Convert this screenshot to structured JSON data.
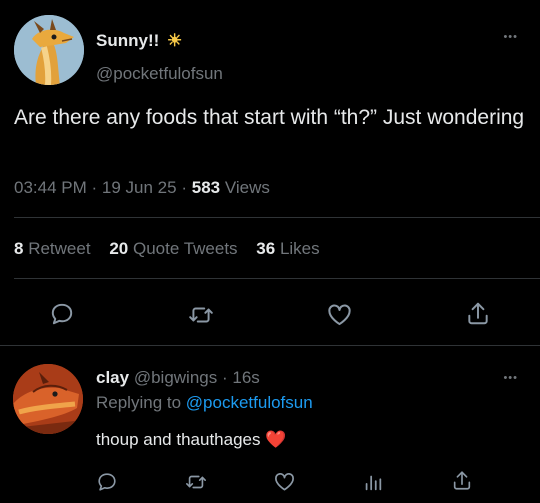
{
  "main_tweet": {
    "display_name": "Sunny!!",
    "name_emoji": "☀",
    "handle": "@pocketfulofsun",
    "text": "Are there any foods that start with “th?” Just wondering",
    "time": "03:44 PM",
    "date": "19 Jun 25",
    "views_count": "583",
    "views_label": "Views",
    "retweet_count": "8",
    "retweet_label": "Retweet",
    "quote_count": "20",
    "quote_label": "Quote Tweets",
    "likes_count": "36",
    "likes_label": "Likes"
  },
  "reply": {
    "display_name": "clay",
    "handle": "@bigwings",
    "time_ago": "16s",
    "replying_label": "Replying to",
    "replying_handle": "@pocketfulofsun",
    "text": "thoup and thauthages",
    "text_emoji": "❤️"
  },
  "separators": {
    "dot": "·"
  },
  "more_label": "•••",
  "colors": {
    "background": "#000000",
    "text": "#e7e9ea",
    "muted": "#71767b",
    "accent": "#1d9bf0",
    "heart": "#f4212e"
  }
}
